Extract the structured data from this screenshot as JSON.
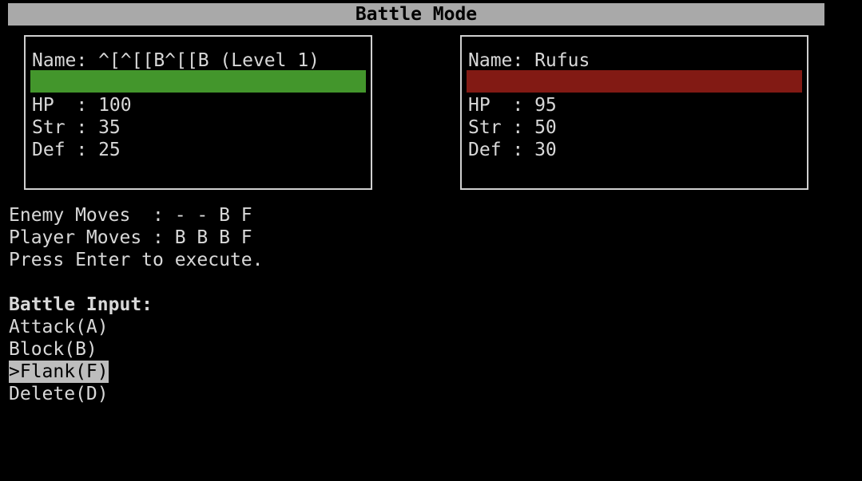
{
  "header": {
    "title": "Battle Mode"
  },
  "player": {
    "name_line": "Name: ^[^[[B^[[B (Level 1)",
    "bar_color": "#43962c",
    "hp_line": "HP  : 100",
    "str_line": "Str : 35",
    "def_line": "Def : 25"
  },
  "enemy": {
    "name_line": "Name: Rufus",
    "bar_color": "#821a14",
    "hp_line": "HP  : 95",
    "str_line": "Str : 50",
    "def_line": "Def : 30"
  },
  "moves": {
    "enemy_line": "Enemy Moves  : - - B F",
    "player_line": "Player Moves : B B B F",
    "prompt": "Press Enter to execute."
  },
  "battle_input": {
    "heading": "Battle Input:",
    "options": [
      {
        "label": "Attack(A)"
      },
      {
        "label": "Block(B)"
      },
      {
        "label": ">Flank(F)"
      },
      {
        "label": "Delete(D)"
      }
    ]
  }
}
